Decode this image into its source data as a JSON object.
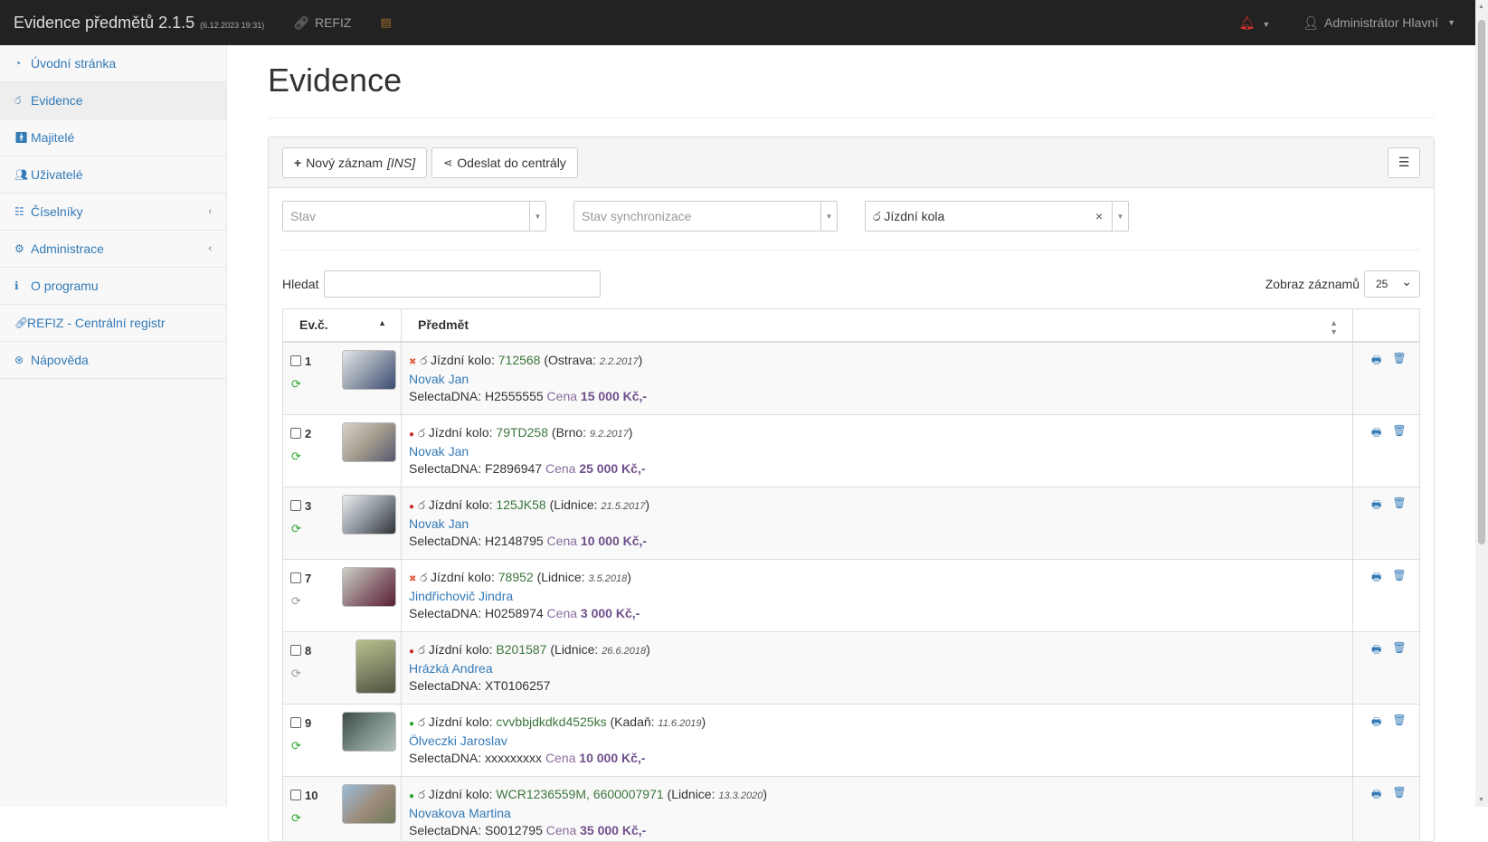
{
  "navbar": {
    "brand": "Evidence předmětů 2.1.5",
    "build": "(6.12.2023 19:31)",
    "refiz_label": "REFIZ",
    "user_label": "Administrátor Hlavní"
  },
  "sidebar": {
    "items": [
      {
        "label": "Úvodní stránka",
        "icon": "dashboard-icon"
      },
      {
        "label": "Evidence",
        "icon": "bicycle-icon"
      },
      {
        "label": "Majitelé",
        "icon": "person-icon"
      },
      {
        "label": "Uživatelé",
        "icon": "users-icon"
      },
      {
        "label": "Číselníky",
        "icon": "sitemap-icon"
      },
      {
        "label": "Administrace",
        "icon": "cogs-icon"
      },
      {
        "label": "O programu",
        "icon": "info-icon"
      },
      {
        "label": "REFIZ - Centrální registr",
        "icon": "link-icon"
      },
      {
        "label": "Nápověda",
        "icon": "lifebuoy-icon"
      }
    ]
  },
  "page": {
    "title": "Evidence"
  },
  "toolbar": {
    "new_label": "Nový záznam",
    "new_shortcut": "[INS]",
    "send_label": "Odeslat do centrály"
  },
  "filters": {
    "stav_placeholder": "Stav",
    "sync_placeholder": "Stav synchronizace",
    "type_value": "Jízdní kola"
  },
  "search": {
    "label": "Hledat",
    "value": ""
  },
  "length": {
    "label": "Zobraz záznamů",
    "value": "25"
  },
  "table": {
    "col_evc": "Ev.č.",
    "col_predmet": "Předmět",
    "rows": [
      {
        "id": "1",
        "sync": "ok",
        "status": "x",
        "type": "Jízdní kolo:",
        "code": "712568",
        "place": "Ostrava:",
        "date": "2.2.2017",
        "owner": "Novak Jan",
        "dna": "SelectaDNA: H2555555",
        "price_label": "Cena",
        "price": "15 000 Kč,-"
      },
      {
        "id": "2",
        "sync": "ok",
        "status": "red",
        "type": "Jízdní kolo:",
        "code": "79TD258",
        "place": "Brno:",
        "date": "9.2.2017",
        "owner": "Novak Jan",
        "dna": "SelectaDNA: F2896947",
        "price_label": "Cena",
        "price": "25 000 Kč,-"
      },
      {
        "id": "3",
        "sync": "ok",
        "status": "red",
        "type": "Jízdní kolo:",
        "code": "125JK58",
        "place": "Lidnice:",
        "date": "21.5.2017",
        "owner": "Novak Jan",
        "dna": "SelectaDNA: H2148795",
        "price_label": "Cena",
        "price": "10 000 Kč,-"
      },
      {
        "id": "7",
        "sync": "no",
        "status": "x",
        "type": "Jízdní kolo:",
        "code": "78952",
        "place": "Lidnice:",
        "date": "3.5.2018",
        "owner": "Jindřichovič Jindra",
        "dna": "SelectaDNA: H0258974",
        "price_label": "Cena",
        "price": "3 000 Kč,-"
      },
      {
        "id": "8",
        "sync": "no",
        "status": "red",
        "type": "Jízdní kolo:",
        "code": "B201587",
        "place": "Lidnice:",
        "date": "26.6.2018",
        "owner": "Hrázká Andrea",
        "dna": "SelectaDNA: XT0106257",
        "price_label": "",
        "price": ""
      },
      {
        "id": "9",
        "sync": "ok",
        "status": "green",
        "type": "Jízdní kolo:",
        "code": "cvvbbjdkdkd4525ks",
        "place": "Kadaň:",
        "date": "11.6.2019",
        "owner": "Ölveczki Jaroslav",
        "dna": "SelectaDNA: xxxxxxxxx",
        "price_label": "Cena",
        "price": "10 000 Kč,-"
      },
      {
        "id": "10",
        "sync": "ok",
        "status": "green",
        "type": "Jízdní kolo:",
        "code": "WCR1236559M, 6600007971",
        "place": "Lidnice:",
        "date": "13.3.2020",
        "owner": "Novakova Martina",
        "dna": "SelectaDNA: S0012795",
        "price_label": "Cena",
        "price": "35 000 Kč,-"
      }
    ]
  }
}
